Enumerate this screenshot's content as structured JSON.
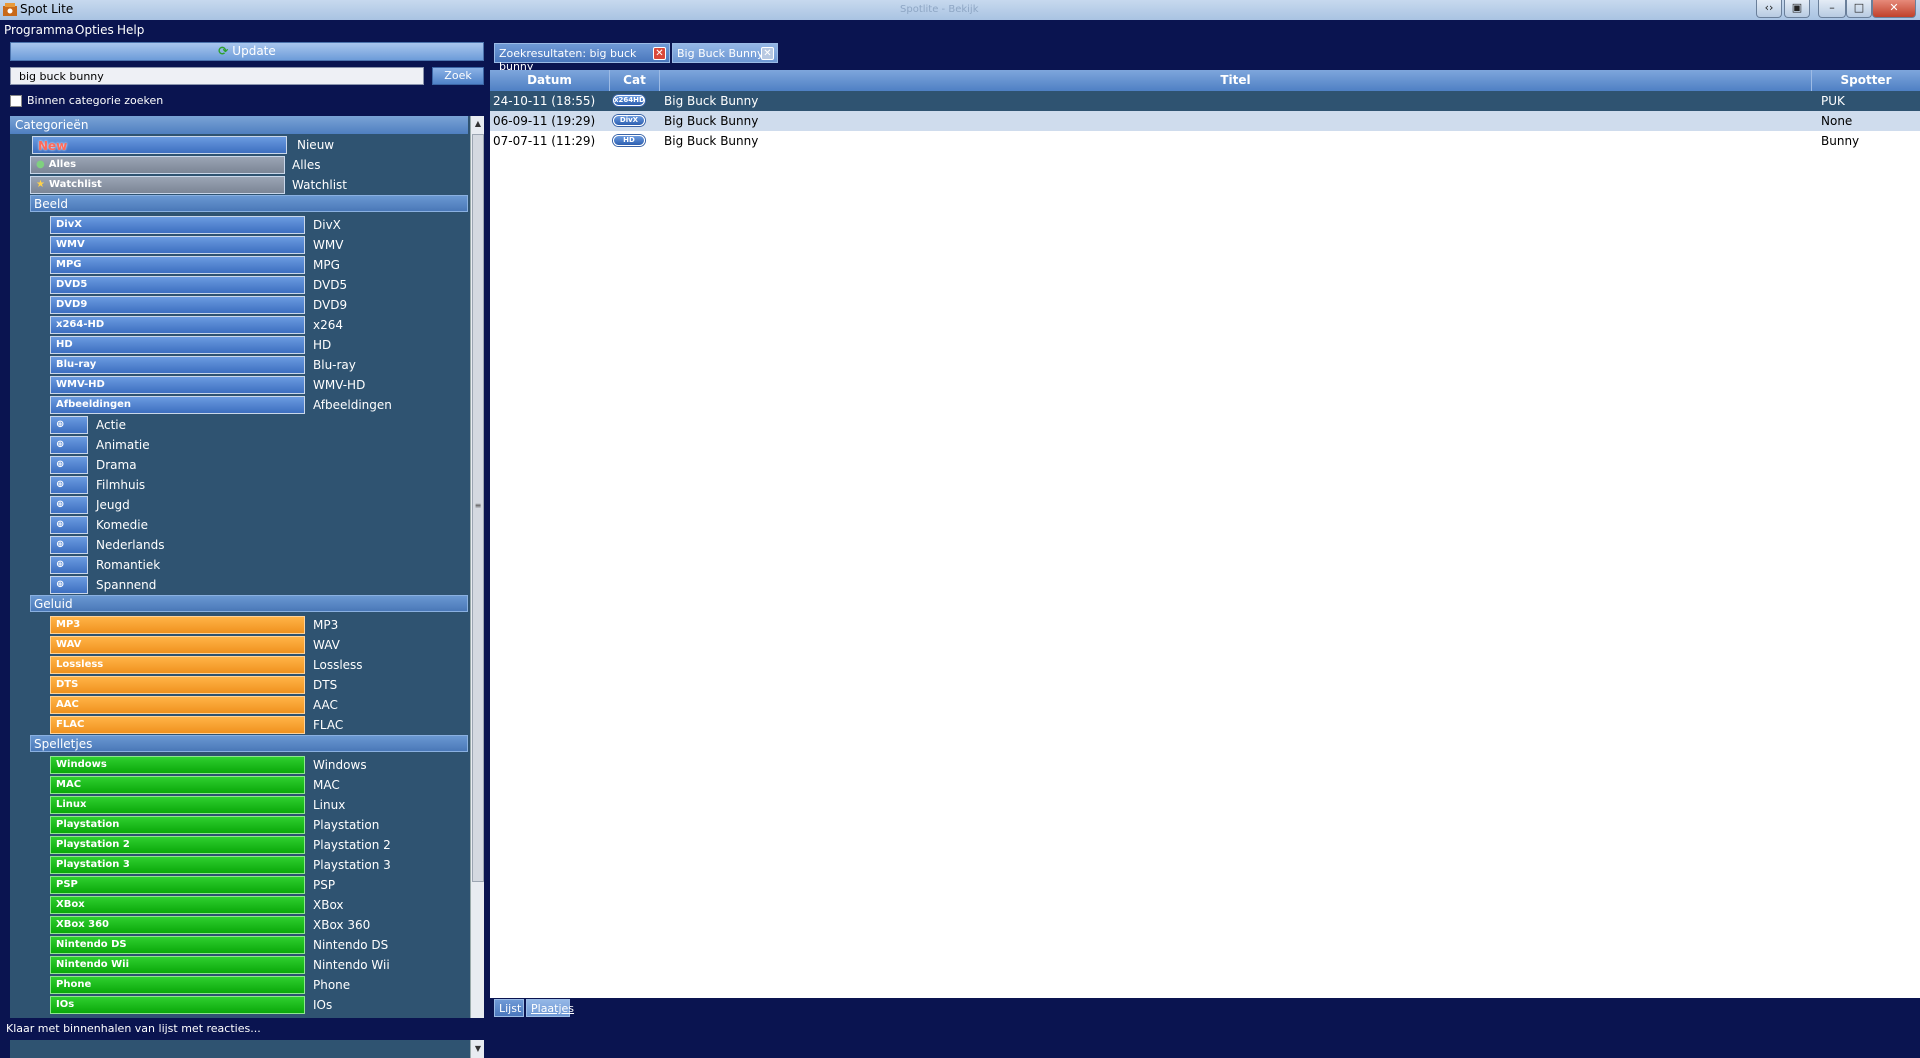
{
  "window": {
    "title": "Spot Lite",
    "ghost_title": "Spotlite - Bekijk"
  },
  "menu": [
    "Programma",
    "Opties",
    "Help"
  ],
  "toolbar": {
    "update_label": "Update",
    "search_value": "big buck bunny",
    "search_button": "Zoek",
    "checkbox_label": "Binnen categorie zoeken"
  },
  "categories": {
    "header": "Categorieën",
    "top": [
      {
        "tag": "New",
        "label": "Nieuw"
      },
      {
        "tag": "Alles",
        "label": "Alles"
      },
      {
        "tag": "Watchlist",
        "label": "Watchlist"
      }
    ],
    "beeld": {
      "title": "Beeld",
      "items": [
        {
          "tag": "DivX",
          "label": "DivX"
        },
        {
          "tag": "WMV",
          "label": "WMV"
        },
        {
          "tag": "MPG",
          "label": "MPG"
        },
        {
          "tag": "DVD5",
          "label": "DVD5"
        },
        {
          "tag": "DVD9",
          "label": "DVD9"
        },
        {
          "tag": "x264-HD",
          "label": "x264"
        },
        {
          "tag": "HD",
          "label": "HD"
        },
        {
          "tag": "Blu-ray",
          "label": "Blu-ray"
        },
        {
          "tag": "WMV-HD",
          "label": "WMV-HD"
        },
        {
          "tag": "Afbeeldingen",
          "label": "Afbeeldingen"
        }
      ],
      "genres": [
        "Actie",
        "Animatie",
        "Drama",
        "Filmhuis",
        "Jeugd",
        "Komedie",
        "Nederlands",
        "Romantiek",
        "Spannend"
      ]
    },
    "geluid": {
      "title": "Geluid",
      "items": [
        {
          "tag": "MP3",
          "label": "MP3"
        },
        {
          "tag": "WAV",
          "label": "WAV"
        },
        {
          "tag": "Lossless",
          "label": "Lossless"
        },
        {
          "tag": "DTS",
          "label": "DTS"
        },
        {
          "tag": "AAC",
          "label": "AAC"
        },
        {
          "tag": "FLAC",
          "label": "FLAC"
        }
      ]
    },
    "spelletjes": {
      "title": "Spelletjes",
      "items": [
        {
          "tag": "Windows",
          "label": "Windows"
        },
        {
          "tag": "MAC",
          "label": "MAC"
        },
        {
          "tag": "Linux",
          "label": "Linux"
        },
        {
          "tag": "Playstation",
          "label": "Playstation"
        },
        {
          "tag": "Playstation 2",
          "label": "Playstation 2"
        },
        {
          "tag": "Playstation 3",
          "label": "Playstation 3"
        },
        {
          "tag": "PSP",
          "label": "PSP"
        },
        {
          "tag": "XBox",
          "label": "XBox"
        },
        {
          "tag": "XBox 360",
          "label": "XBox 360"
        },
        {
          "tag": "Nintendo DS",
          "label": "Nintendo DS"
        },
        {
          "tag": "Nintendo Wii",
          "label": "Nintendo Wii"
        },
        {
          "tag": "Phone",
          "label": "Phone"
        },
        {
          "tag": "IOs",
          "label": "IOs"
        }
      ]
    }
  },
  "tabs": [
    {
      "label": "Zoekresultaten: big buck bunny"
    },
    {
      "label": "Big Buck Bunny"
    }
  ],
  "table": {
    "columns": [
      "Datum",
      "Cat",
      "Titel",
      "Spotter"
    ],
    "rows": [
      {
        "datum": "24-10-11 (18:55)",
        "cat": "x264HD",
        "titel": "Big Buck Bunny",
        "spotter": "PUK"
      },
      {
        "datum": "06-09-11 (19:29)",
        "cat": "DivX",
        "titel": "Big Buck Bunny",
        "spotter": "None"
      },
      {
        "datum": "07-07-11 (11:29)",
        "cat": "HD",
        "titel": "Big Buck Bunny",
        "spotter": "Bunny"
      }
    ]
  },
  "bottom_tabs": [
    "Lijst",
    "Plaatjes"
  ],
  "status": "Klaar met binnenhalen van lijst met reacties...",
  "colors": {
    "background": "#0a1450",
    "panel": "#2f5371",
    "blue_tag": "#4a7bc8",
    "orange_tag": "#f5a030",
    "green_tag": "#14b814",
    "selected_row": "#cfdced",
    "header_row": "#2f5371"
  }
}
